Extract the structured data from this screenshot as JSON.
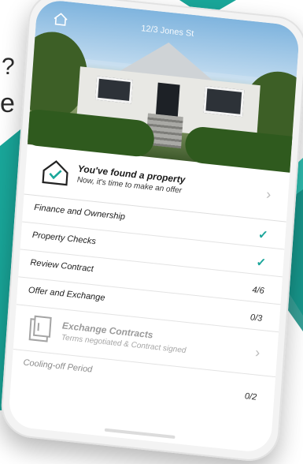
{
  "colors": {
    "teal": "#19a79a",
    "light_teal": "#2fc1b3",
    "dark_teal": "#128a80"
  },
  "left_text_top": "?",
  "left_text_bottom": "e",
  "header": {
    "address": "12/3 Jones St",
    "home_icon": "home-icon"
  },
  "property": {
    "title": "You've found a property",
    "subtitle": "Now, it's time to make an offer",
    "icon": "house-check-icon"
  },
  "steps": [
    {
      "label": "Finance and Ownership",
      "status": "done"
    },
    {
      "label": "Property Checks",
      "status": "done"
    },
    {
      "label": "Review Contract",
      "value": "4/6"
    },
    {
      "label": "Offer and Exchange",
      "value": "0/3"
    }
  ],
  "exchange": {
    "title": "Exchange Contracts",
    "subtitle": "Terms negotiated & Contract signed",
    "icon": "document-icon"
  },
  "cooling": {
    "label": "Cooling-off Period",
    "value": "0/2"
  }
}
